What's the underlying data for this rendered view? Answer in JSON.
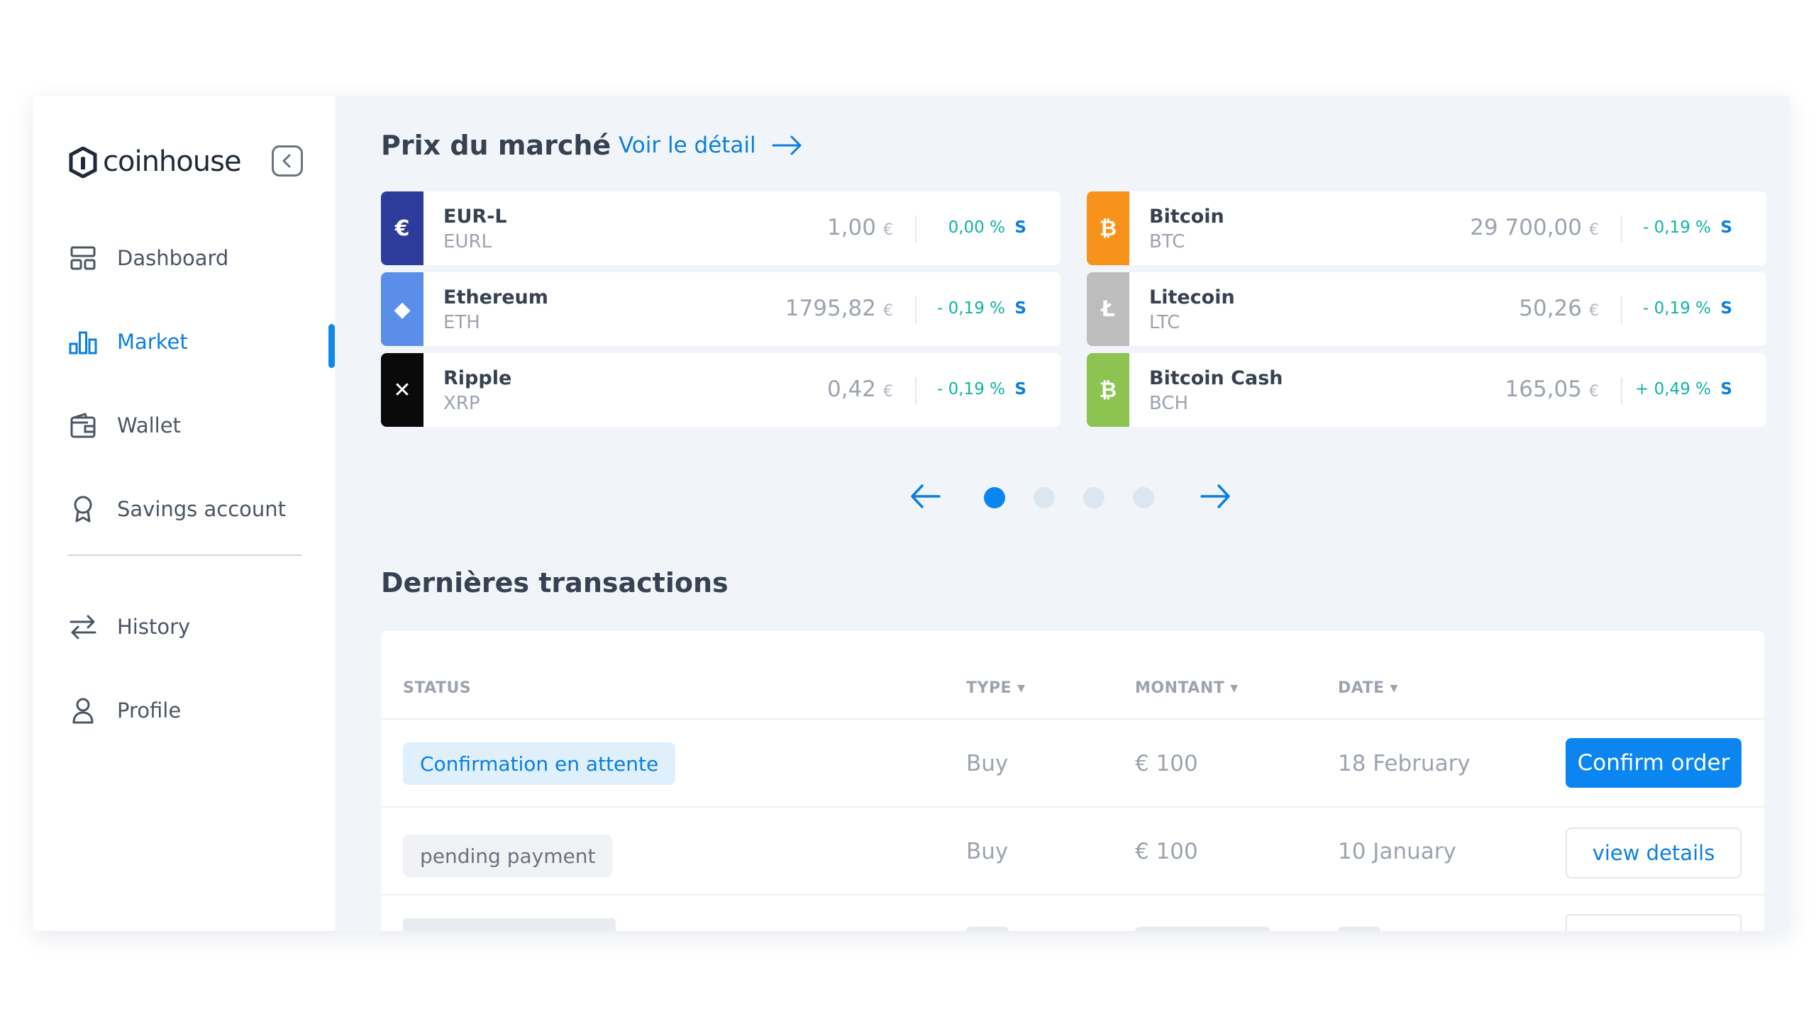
{
  "sidebar": {
    "logo_text": "coinhouse",
    "items": [
      {
        "label": "Dashboard",
        "icon": "dashboard-icon"
      },
      {
        "label": "Market",
        "icon": "bar-chart-icon",
        "active": true
      },
      {
        "label": "Wallet",
        "icon": "wallet-icon"
      },
      {
        "label": "Savings account",
        "icon": "badge-icon"
      }
    ],
    "items2": [
      {
        "label": "History",
        "icon": "arrows-swap-icon"
      },
      {
        "label": "Profile",
        "icon": "user-icon"
      }
    ]
  },
  "market": {
    "title": "Prix du marché",
    "detail_link": "Voir le détail",
    "coins": [
      {
        "name": "EUR-L",
        "ticker": "EURL",
        "price": "1,00",
        "currency": "€",
        "change": "0,00 %",
        "s": "S",
        "color": "#2d3c9a",
        "icon": "eurl-icon",
        "glyph": "€"
      },
      {
        "name": "Bitcoin",
        "ticker": "BTC",
        "price": "29 700,00",
        "currency": "€",
        "change": "- 0,19 %",
        "s": "S",
        "color": "#f7931a",
        "icon": "bitcoin-icon",
        "glyph": "₿"
      },
      {
        "name": "Ethereum",
        "ticker": "ETH",
        "price": "1795,82",
        "currency": "€",
        "change": "- 0,19 %",
        "s": "S",
        "color": "#5b8ee8",
        "icon": "ethereum-icon",
        "glyph": "◆"
      },
      {
        "name": "Litecoin",
        "ticker": "LTC",
        "price": "50,26",
        "currency": "€",
        "change": "- 0,19 %",
        "s": "S",
        "color": "#bdbdbd",
        "icon": "litecoin-icon",
        "glyph": "Ł"
      },
      {
        "name": "Ripple",
        "ticker": "XRP",
        "price": "0,42",
        "currency": "€",
        "change": "- 0,19 %",
        "s": "S",
        "color": "#0a0a0a",
        "icon": "ripple-icon",
        "glyph": "✕"
      },
      {
        "name": "Bitcoin Cash",
        "ticker": "BCH",
        "price": "165,05",
        "currency": "€",
        "change": "+ 0,49 %",
        "s": "S",
        "color": "#8dc351",
        "icon": "bitcoin-cash-icon",
        "glyph": "₿"
      }
    ],
    "pager": {
      "current": 1,
      "total": 4
    }
  },
  "transactions": {
    "title": "Dernières transactions",
    "columns": {
      "status": "STATUS",
      "type": "TYPE",
      "amount": "MONTANT",
      "date": "DATE"
    },
    "rows": [
      {
        "status": "Confirmation en attente",
        "type": "Buy",
        "amount": "€ 100",
        "date": "18 February",
        "action": "Confirm order"
      },
      {
        "status": "pending payment",
        "type": "Buy",
        "amount": "€ 100",
        "date": "10 January",
        "action": "view details"
      }
    ]
  }
}
